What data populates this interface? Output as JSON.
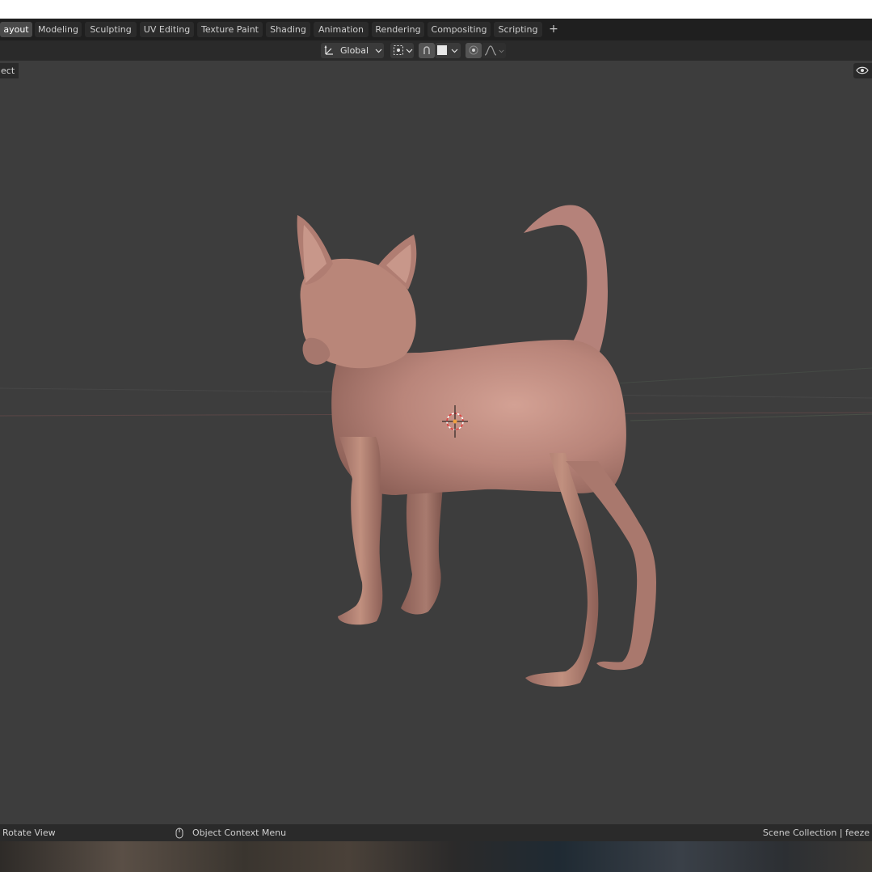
{
  "tabs": [
    {
      "label": "Layout",
      "display": "ayout",
      "active": true
    },
    {
      "label": "Modeling"
    },
    {
      "label": "Sculpting"
    },
    {
      "label": "UV Editing"
    },
    {
      "label": "Texture Paint"
    },
    {
      "label": "Shading"
    },
    {
      "label": "Animation"
    },
    {
      "label": "Rendering"
    },
    {
      "label": "Compositing"
    },
    {
      "label": "Scripting"
    }
  ],
  "header": {
    "orientation": "Global",
    "mode_label": "ect"
  },
  "status": {
    "left": "Rotate View",
    "middle": "Object Context Menu",
    "right": "Scene Collection | feeze"
  },
  "colors": {
    "viewport": "#3d3d3d",
    "model": "#b9857a",
    "active_tab": "#4a4a4a"
  },
  "icons": [
    "orientation-icon",
    "pivot-icon",
    "snap-icon",
    "snap-element-icon",
    "proportional-icon",
    "falloff-icon",
    "eye-icon",
    "mouse-icon",
    "cursor-3d-icon"
  ]
}
